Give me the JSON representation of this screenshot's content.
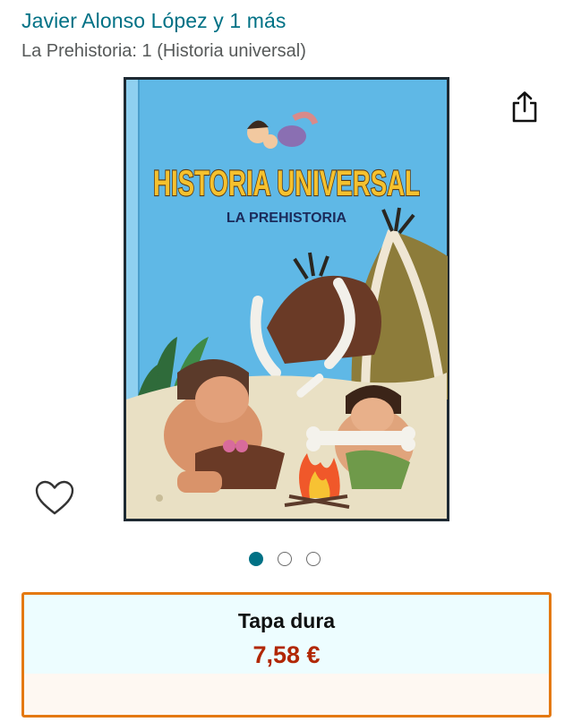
{
  "product": {
    "author_line": "Javier Alonso López y 1 más",
    "title_line": "La Prehistoria: 1 (Historia universal)"
  },
  "cover": {
    "series_title": "HISTORIA UNIVERSAL",
    "book_subtitle": "LA PREHISTORIA"
  },
  "icons": {
    "share": "share-icon",
    "wishlist": "heart-icon"
  },
  "carousel": {
    "count": 3,
    "active_index": 0
  },
  "format": {
    "label": "Tapa dura",
    "price": "7,58 €"
  },
  "colors": {
    "link": "#007185",
    "price": "#B12704",
    "selected_border": "#E47911",
    "cover_sky": "#5fb8e6"
  }
}
